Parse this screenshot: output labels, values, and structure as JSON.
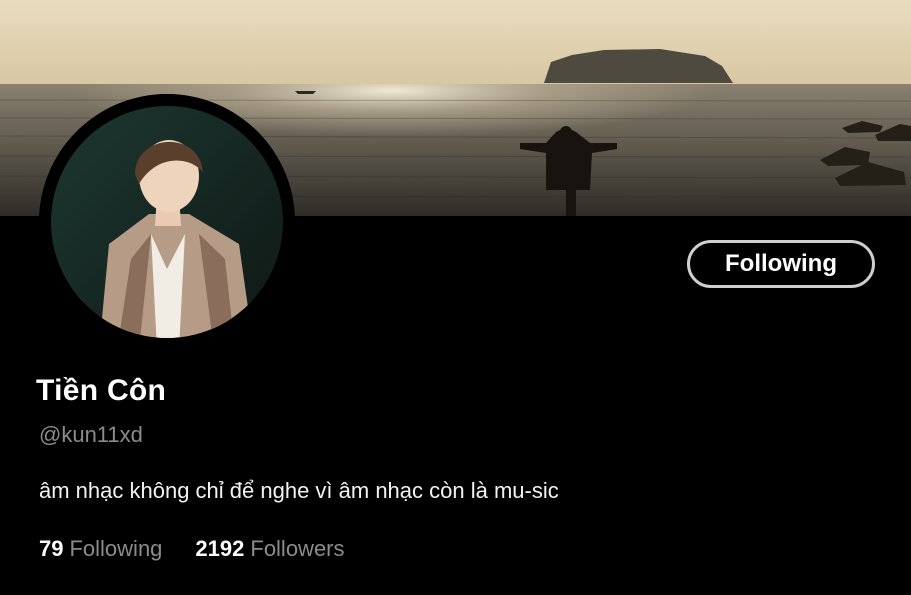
{
  "banner": {
    "description_icon": "seascape-banner-image"
  },
  "avatar": {
    "icon": "profile-avatar-image"
  },
  "follow_button": {
    "label": "Following"
  },
  "profile": {
    "display_name": "Tiền Côn",
    "handle": "@kun11xd",
    "bio": "âm nhạc không chỉ để nghe vì âm nhạc còn là mu-sic"
  },
  "stats": [
    {
      "count": "79",
      "label": "Following"
    },
    {
      "count": "2192",
      "label": "Followers"
    }
  ],
  "colors": {
    "background": "#000000",
    "text_primary": "#ffffff",
    "text_secondary": "#8b8b8b",
    "button_border": "#cfcfcf"
  }
}
